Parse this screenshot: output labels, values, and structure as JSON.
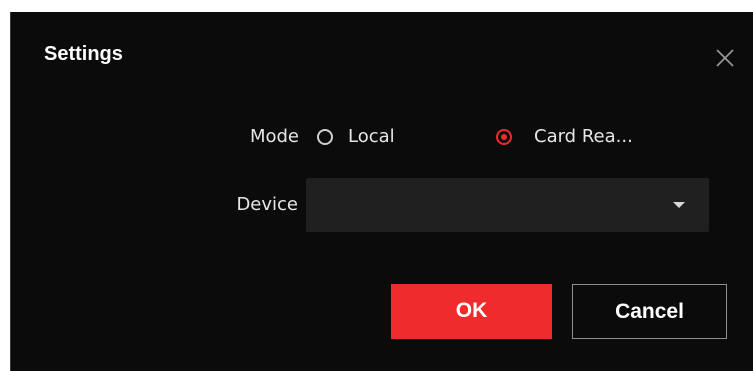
{
  "dialog": {
    "title": "Settings",
    "close_icon": "close-icon"
  },
  "mode": {
    "label": "Mode",
    "options": [
      {
        "label": "Local",
        "selected": false
      },
      {
        "label": "Card Rea...",
        "selected": true
      }
    ]
  },
  "device": {
    "label": "Device",
    "value": "",
    "dropdown_icon": "chevron-down-icon"
  },
  "buttons": {
    "ok_label": "OK",
    "cancel_label": "Cancel"
  },
  "colors": {
    "accent": "#ef2b2d",
    "background": "#0b0b0b",
    "field": "#202020"
  }
}
